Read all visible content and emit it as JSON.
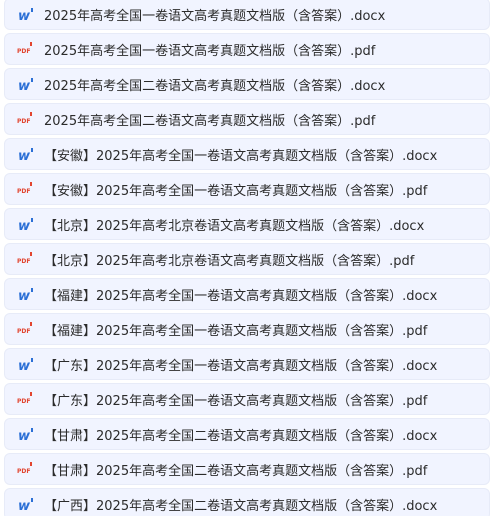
{
  "files": [
    {
      "name": "2025年高考全国一卷语文高考真题文档版（含答案）.docx",
      "type": "docx",
      "icon": "word-icon"
    },
    {
      "name": "2025年高考全国一卷语文高考真题文档版（含答案）.pdf",
      "type": "pdf",
      "icon": "pdf-icon"
    },
    {
      "name": "2025年高考全国二卷语文高考真题文档版（含答案）.docx",
      "type": "docx",
      "icon": "word-icon"
    },
    {
      "name": "2025年高考全国二卷语文高考真题文档版（含答案）.pdf",
      "type": "pdf",
      "icon": "pdf-icon"
    },
    {
      "name": "【安徽】2025年高考全国一卷语文高考真题文档版（含答案）.docx",
      "type": "docx",
      "icon": "word-icon"
    },
    {
      "name": "【安徽】2025年高考全国一卷语文高考真题文档版（含答案）.pdf",
      "type": "pdf",
      "icon": "pdf-icon"
    },
    {
      "name": "【北京】2025年高考北京卷语文高考真题文档版（含答案）.docx",
      "type": "docx",
      "icon": "word-icon"
    },
    {
      "name": "【北京】2025年高考北京卷语文高考真题文档版（含答案）.pdf",
      "type": "pdf",
      "icon": "pdf-icon"
    },
    {
      "name": "【福建】2025年高考全国一卷语文高考真题文档版（含答案）.docx",
      "type": "docx",
      "icon": "word-icon"
    },
    {
      "name": "【福建】2025年高考全国一卷语文高考真题文档版（含答案）.pdf",
      "type": "pdf",
      "icon": "pdf-icon"
    },
    {
      "name": "【广东】2025年高考全国一卷语文高考真题文档版（含答案）.docx",
      "type": "docx",
      "icon": "word-icon"
    },
    {
      "name": "【广东】2025年高考全国一卷语文高考真题文档版（含答案）.pdf",
      "type": "pdf",
      "icon": "pdf-icon"
    },
    {
      "name": "【甘肃】2025年高考全国二卷语文高考真题文档版（含答案）.docx",
      "type": "docx",
      "icon": "word-icon"
    },
    {
      "name": "【甘肃】2025年高考全国二卷语文高考真题文档版（含答案）.pdf",
      "type": "pdf",
      "icon": "pdf-icon"
    },
    {
      "name": "【广西】2025年高考全国二卷语文高考真题文档版（含答案）.docx",
      "type": "docx",
      "icon": "word-icon"
    }
  ],
  "colors": {
    "row_background": "#f1f4ff",
    "word_icon": "#2b6fd6",
    "pdf_icon": "#e2452f"
  }
}
